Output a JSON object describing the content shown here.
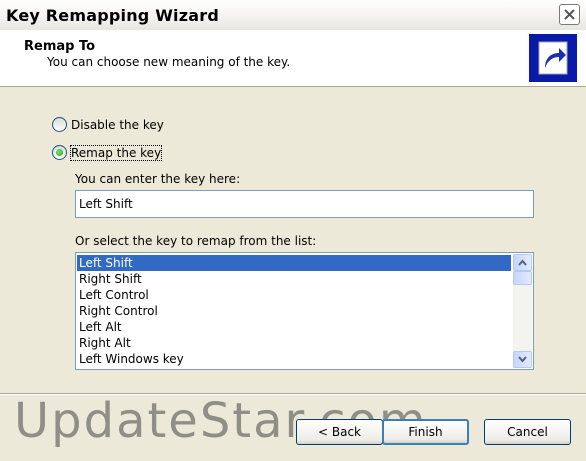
{
  "window": {
    "title": "Key Remapping Wizard"
  },
  "header": {
    "title": "Remap To",
    "subtitle": "You can choose new meaning of the key."
  },
  "options": {
    "disable_label": "Disable the key",
    "remap_label": "Remap the key",
    "selected": "remap"
  },
  "key_entry": {
    "label": "You can enter the key here:",
    "value": "Left Shift"
  },
  "key_list": {
    "label": "Or select the key to remap from the list:",
    "items": [
      "Left Shift",
      "Right Shift",
      "Left Control",
      "Right Control",
      "Left Alt",
      "Right Alt",
      "Left Windows key"
    ],
    "selected_index": 0
  },
  "buttons": {
    "back": "< Back",
    "finish": "Finish",
    "cancel": "Cancel"
  },
  "watermark": "UpdateStar.com",
  "colors": {
    "selection": "#316ac5",
    "header_icon": "#0a1aa8",
    "radio_checked": "#21a121"
  },
  "icons": {
    "close": "close-icon",
    "header": "shortcut-arrow-icon",
    "scroll_up": "chevron-up-icon",
    "scroll_down": "chevron-down-icon"
  }
}
